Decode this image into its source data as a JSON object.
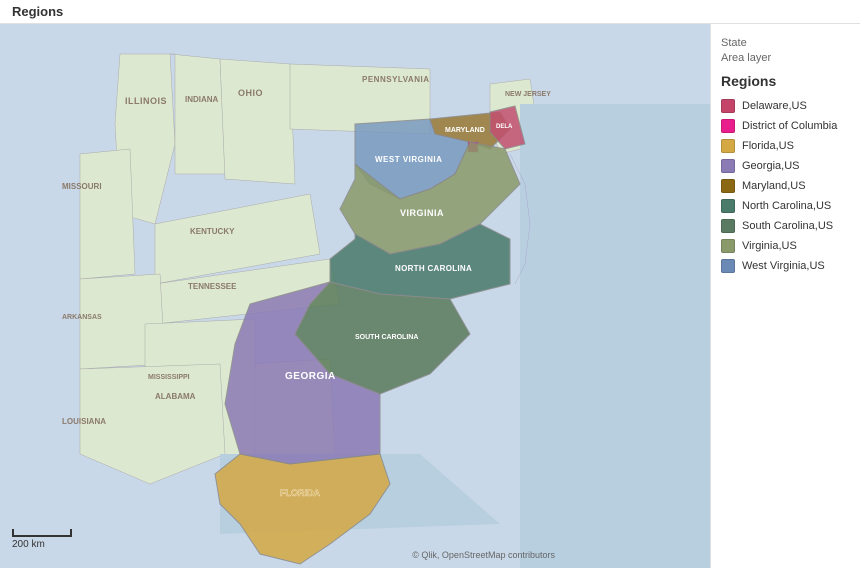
{
  "title": "Regions",
  "legend": {
    "layer_line1": "State",
    "layer_line2": "Area layer",
    "title": "Regions",
    "items": [
      {
        "label": "Delaware,US",
        "color": "#c44569"
      },
      {
        "label": "District of Columbia",
        "color": "#e91e8c"
      },
      {
        "label": "Florida,US",
        "color": "#d4a843"
      },
      {
        "label": "Georgia,US",
        "color": "#8b7bb5"
      },
      {
        "label": "Maryland,US",
        "color": "#8b6914"
      },
      {
        "label": "North Carolina,US",
        "color": "#4a7a6a"
      },
      {
        "label": "South Carolina,US",
        "color": "#5a7a62"
      },
      {
        "label": "Virginia,US",
        "color": "#8a9a6a"
      },
      {
        "label": "West Virginia,US",
        "color": "#6a8ab5"
      }
    ]
  },
  "scale": {
    "label": "200 km"
  },
  "attribution": "© Qlik, OpenStreetMap contributors"
}
